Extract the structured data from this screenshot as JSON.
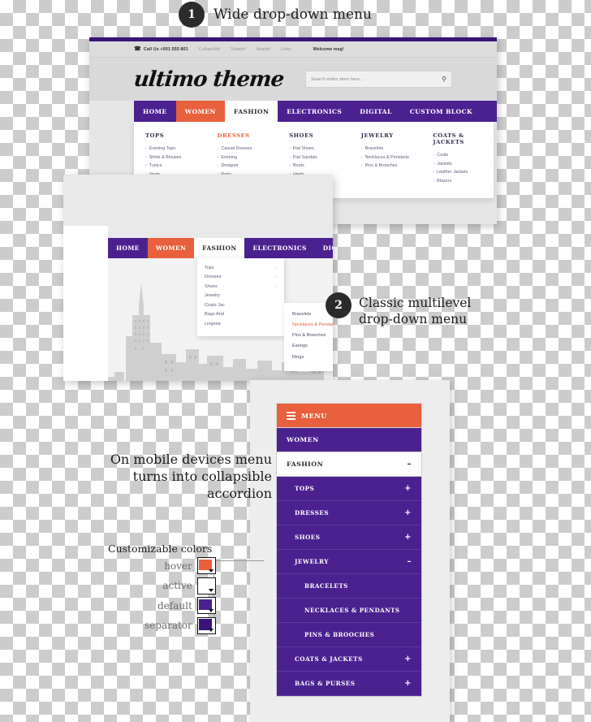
{
  "annotations": {
    "callout1": {
      "number": "1",
      "text": "Wide drop-down menu"
    },
    "callout2": {
      "number": "2",
      "text": "Classic multilevel drop-down menu"
    },
    "mobile_note": "On mobile devices menu turns into collapsible accordion",
    "colors_title": "Customizable colors",
    "color_swatches": [
      {
        "label": "hover",
        "hex": "#e8603c"
      },
      {
        "label": "active",
        "hex": "#ffffff"
      },
      {
        "label": "default",
        "hex": "#4b2190"
      },
      {
        "label": "separator",
        "hex": "#3a1478"
      }
    ]
  },
  "theme_colors": {
    "purple": "#4b2190",
    "dark_purple": "#3a1478",
    "orange": "#e8603c",
    "white": "#ffffff"
  },
  "wide_menu_screenshot": {
    "topbar": {
      "phone_icon": "telephone-icon",
      "phone": "Call Us +001 555 801",
      "links": [
        "Collapsible",
        "Sample",
        "Header",
        "Links"
      ],
      "welcome": "Welcome msg!"
    },
    "logo": "ultimo theme",
    "search": {
      "placeholder": "Search entire store here...",
      "icon": "search-icon"
    },
    "nav": [
      {
        "label": "HOME",
        "state": "default"
      },
      {
        "label": "WOMEN",
        "state": "hover"
      },
      {
        "label": "FASHION",
        "state": "active"
      },
      {
        "label": "ELECTRONICS",
        "state": "default"
      },
      {
        "label": "DIGITAL",
        "state": "default"
      },
      {
        "label": "CUSTOM BLOCK",
        "state": "default"
      }
    ],
    "mega_columns": [
      {
        "title": "TOPS",
        "highlight": false,
        "items": [
          "Evening Tops",
          "Shirts & Blouses",
          "Tunics",
          "Vests"
        ]
      },
      {
        "title": "DRESSES",
        "highlight": true,
        "items": [
          "Casual Dresses",
          "Evening",
          "Designer",
          "Party"
        ]
      },
      {
        "title": "SHOES",
        "highlight": false,
        "items": [
          "Flat Shoes",
          "Flat Sandals",
          "Boots",
          "Heels"
        ]
      },
      {
        "title": "JEWELRY",
        "highlight": false,
        "items": [
          "Bracelets",
          "Necklaces & Pendants",
          "Pins & Brooches"
        ]
      },
      {
        "title": "COATS & JACKETS",
        "highlight": false,
        "items": [
          "Coats",
          "Jackets",
          "Leather Jackets",
          "Blazers"
        ]
      }
    ]
  },
  "multilevel_screenshot": {
    "nav": [
      {
        "label": "HOME",
        "state": "default"
      },
      {
        "label": "WOMEN",
        "state": "hover"
      },
      {
        "label": "FASHION",
        "state": "active"
      },
      {
        "label": "ELECTRONICS",
        "state": "default"
      },
      {
        "label": "DIGITAL",
        "state": "default"
      }
    ],
    "level1": [
      {
        "label": "Tops",
        "caret": "›"
      },
      {
        "label": "Dresses",
        "caret": "›"
      },
      {
        "label": "Shoes",
        "caret": "›"
      },
      {
        "label": "Jewelry",
        "caret": ""
      },
      {
        "label": "Coats Jac",
        "caret": ""
      },
      {
        "label": "Bags And",
        "caret": ""
      },
      {
        "label": "Lingerie",
        "caret": ""
      }
    ],
    "level2": [
      {
        "label": "Bracelets",
        "highlight": false
      },
      {
        "label": "Necklaces & Pendants",
        "highlight": true
      },
      {
        "label": "Pins & Brooches",
        "highlight": false
      },
      {
        "label": "Earings",
        "highlight": false
      },
      {
        "label": "Rings",
        "highlight": false
      }
    ]
  },
  "mobile_screenshot": {
    "menu_button": {
      "label": "MENU",
      "icon": "hamburger-icon"
    },
    "items": [
      {
        "label": "WOMEN",
        "level": 1,
        "sign": "",
        "state": "closed"
      },
      {
        "label": "FASHION",
        "level": 1,
        "sign": "–",
        "state": "open"
      },
      {
        "label": "TOPS",
        "level": 2,
        "sign": "+",
        "state": "closed"
      },
      {
        "label": "DRESSES",
        "level": 2,
        "sign": "+",
        "state": "closed"
      },
      {
        "label": "SHOES",
        "level": 2,
        "sign": "+",
        "state": "closed"
      },
      {
        "label": "JEWELRY",
        "level": 2,
        "sign": "–",
        "state": "open"
      },
      {
        "label": "BRACELETS",
        "level": 3,
        "sign": "",
        "state": "closed"
      },
      {
        "label": "NECKLACES & PENDANTS",
        "level": 3,
        "sign": "",
        "state": "closed"
      },
      {
        "label": "PINS & BROOCHES",
        "level": 3,
        "sign": "",
        "state": "closed"
      },
      {
        "label": "COATS & JACKETS",
        "level": 2,
        "sign": "+",
        "state": "closed"
      },
      {
        "label": "BAGS & PURSES",
        "level": 2,
        "sign": "+",
        "state": "closed"
      }
    ]
  }
}
